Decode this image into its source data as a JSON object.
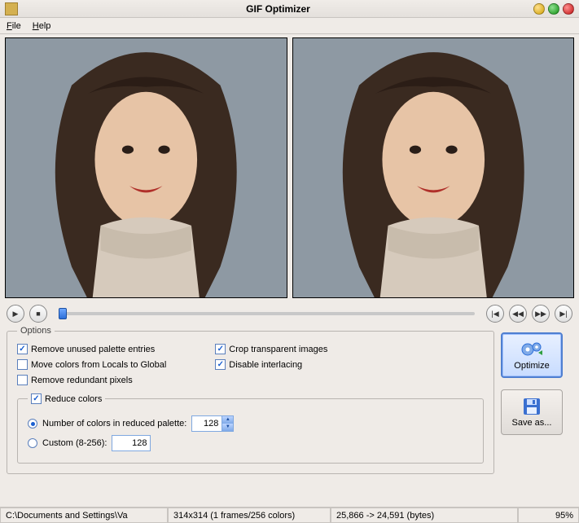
{
  "window": {
    "title": "GIF Optimizer"
  },
  "menu": {
    "file": "File",
    "help": "Help"
  },
  "icons": {
    "play": "▶",
    "stop": "■",
    "first": "|◀",
    "prev": "◀◀",
    "next": "▶▶",
    "last": "▶|"
  },
  "options": {
    "legend": "Options",
    "remove_unused": {
      "label": "Remove unused palette entries",
      "checked": true
    },
    "move_colors": {
      "label": "Move colors from Locals to Global",
      "checked": false
    },
    "remove_redundant": {
      "label": "Remove redundant pixels",
      "checked": false
    },
    "crop_transparent": {
      "label": "Crop transparent images",
      "checked": true
    },
    "disable_interlacing": {
      "label": "Disable interlacing",
      "checked": true
    }
  },
  "reduce": {
    "legend_label": "Reduce colors",
    "legend_checked": true,
    "num_label": "Number of colors in reduced palette:",
    "num_value": "128",
    "num_selected": true,
    "custom_label": "Custom (8-256):",
    "custom_value": "128",
    "custom_selected": false
  },
  "buttons": {
    "optimize": "Optimize",
    "save_as": "Save as..."
  },
  "status": {
    "path": "C:\\Documents and Settings\\Va",
    "dims": "314x314 (1 frames/256 colors)",
    "bytes": "25,866 -> 24,591 (bytes)",
    "pct": "95%"
  }
}
